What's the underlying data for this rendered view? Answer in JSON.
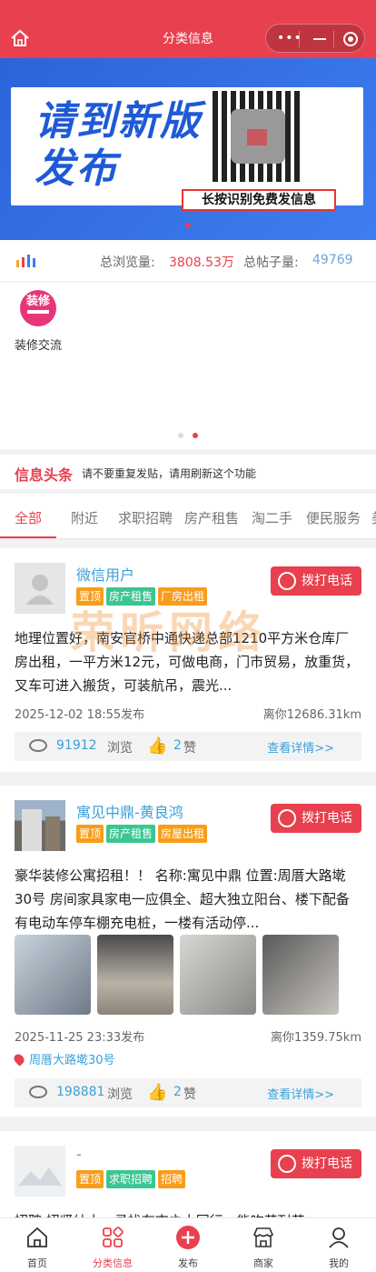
{
  "topbar": {
    "title": "分类信息",
    "menu_dots": "•••"
  },
  "banner": {
    "line1": "请到新版",
    "line2": "发布",
    "caption": "长按识别免费发信息",
    "colors": {
      "bg": "#2b64d8",
      "text": "#1e5ad6"
    }
  },
  "stats": {
    "views_label": "总浏览量:",
    "views_value": "3808.53万",
    "posts_label": "总帖子量:",
    "posts_value": "49769"
  },
  "categories": [
    {
      "label": "装修交流",
      "icon": "装修"
    }
  ],
  "notice": {
    "heading": "信息头条",
    "text": "请不要重复发贴，请用刷新这个功能"
  },
  "tabs": [
    "全部",
    "附近",
    "求职招聘",
    "房产租售",
    "淘二手",
    "便民服务",
    "美"
  ],
  "watermark": "荣昕网络",
  "posts": [
    {
      "name": "微信用户",
      "tags": [
        {
          "text": "置顶",
          "color": "orange"
        },
        {
          "text": "房产租售",
          "color": "green"
        },
        {
          "text": "厂房出租",
          "color": "orange"
        }
      ],
      "call": "拨打电话",
      "content": "地理位置好，南安官桥中通快递总部1210平方米仓库厂房出租，一平方米12元，可做电商，门市贸易，放重货，叉车可进入搬货，可装航吊，震光...",
      "date": "2025-12-02 18:55发布",
      "distance": "离你12686.31km",
      "views": "91912",
      "views_label": "浏览",
      "likes": "2",
      "likes_label": "赞",
      "more": "查看详情>>"
    },
    {
      "name": "寓见中鼎-黄良鸿",
      "tags": [
        {
          "text": "置顶",
          "color": "orange"
        },
        {
          "text": "房产租售",
          "color": "green"
        },
        {
          "text": "房屋出租",
          "color": "orange"
        }
      ],
      "call": "拨打电话",
      "content": "豪华装修公寓招租！！ 名称:寓见中鼎 位置:周厝大路墘30号 房间家具家电一应俱全、超大独立阳台、楼下配备有电动车停车棚充电桩，一楼有活动停...",
      "date": "2025-11-25 23:33发布",
      "distance": "离你1359.75km",
      "address": "周厝大路墘30号",
      "views": "198881",
      "views_label": "浏览",
      "likes": "2",
      "likes_label": "赞",
      "more": "查看详情>>"
    },
    {
      "name": "-",
      "tags": [
        {
          "text": "置顶",
          "color": "orange"
        },
        {
          "text": "求职招聘",
          "color": "green"
        },
        {
          "text": "招聘",
          "color": "orange"
        }
      ],
      "call": "拨打电话",
      "content": "招聘 招贤纳士，寻找有志之士同行，能吃苦耐劳"
    }
  ],
  "tabbar": [
    {
      "label": "首页",
      "icon": "home-icon"
    },
    {
      "label": "分类信息",
      "icon": "category-icon",
      "active": true
    },
    {
      "label": "发布",
      "icon": "publish-icon"
    },
    {
      "label": "商家",
      "icon": "shop-icon"
    },
    {
      "label": "我的",
      "icon": "user-icon"
    }
  ]
}
